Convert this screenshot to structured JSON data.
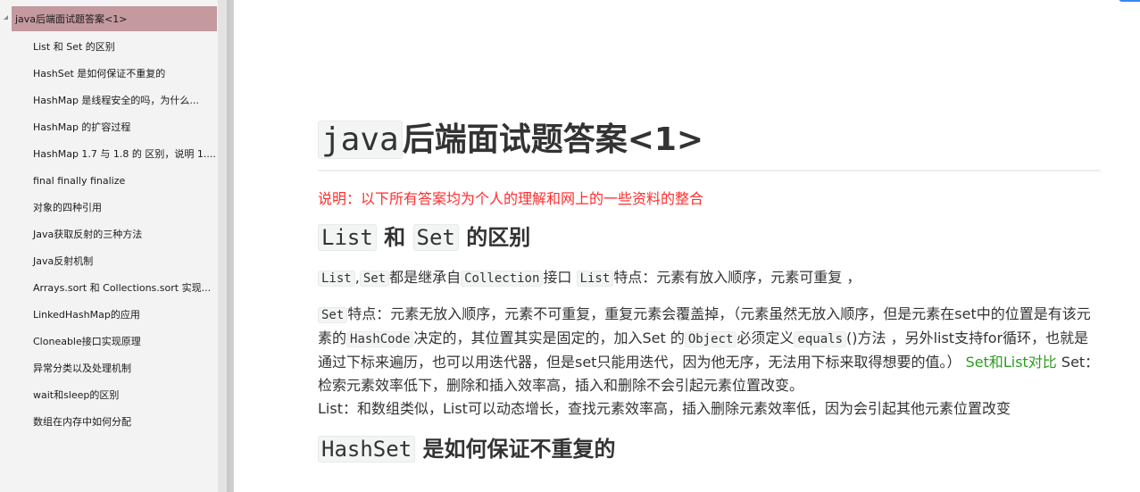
{
  "outline": {
    "root": "java后端面试题答案<1>",
    "items": [
      "List 和 Set 的区别",
      "HashSet 是如何保证不重复的",
      "HashMap 是线程安全的吗，为什么...",
      "HashMap 的扩容过程",
      "HashMap 1.7 与 1.8 的 区别，说明 1....",
      "final finally finalize",
      "对象的四种引用",
      "Java获取反射的三种方法",
      "Java反射机制",
      "Arrays.sort 和 Collections.sort 实现...",
      "LinkedHashMap的应用",
      "Cloneable接口实现原理",
      "异常分类以及处理机制",
      "wait和sleep的区别",
      "数组在内存中如何分配"
    ]
  },
  "document": {
    "title_code": "java",
    "title_text": "后端面试题答案<1>",
    "note": "说明：以下所有答案均为个人的理解和网上的一些资料的整合",
    "section1": {
      "code_a": "List",
      "and": "和",
      "code_b": "Set",
      "suffix": "的区别"
    },
    "para1": {
      "c1": "List",
      "sep": ",",
      "c2": "Set",
      "t1": "都是继承自",
      "c3": "Collection",
      "t2": "接口",
      "c4": "List",
      "t3": "特点：元素有放入顺序，元素可重复 ，"
    },
    "para2": {
      "c1": "Set",
      "t1": "特点：元素无放入顺序，元素不可重复，重复元素会覆盖掉，（元素虽然无放入顺序，但是元素在set中的位置是有该元素的",
      "c2": "HashCode",
      "t2": "决定的，其位置其实是固定的，加入Set 的",
      "c3": "Object",
      "t3": "必须定义",
      "c4": "equals",
      "t4": "()方法 ，另外list支持for循环，也就是通过下标来遍历，也可以用迭代器，但是set只能用迭代，因为他无序，无法用下标来取得想要的值。）",
      "green": "Set和List对比",
      "t5": "Set：检索元素效率低下，删除和插入效率高，插入和删除不会引起元素位置改变。",
      "t6": "List：和数组类似，List可以动态增长，查找元素效率高，插入删除元素效率低，因为会引起其他元素位置改变"
    },
    "section2": {
      "code": "HashSet",
      "suffix": "是如何保证不重复的"
    }
  },
  "colors": {
    "selected_outline_bg": "#c4999f",
    "note_red": "#ff2d2d",
    "link_green": "#2a9d1e",
    "indicator_blue": "#3b86f0"
  }
}
